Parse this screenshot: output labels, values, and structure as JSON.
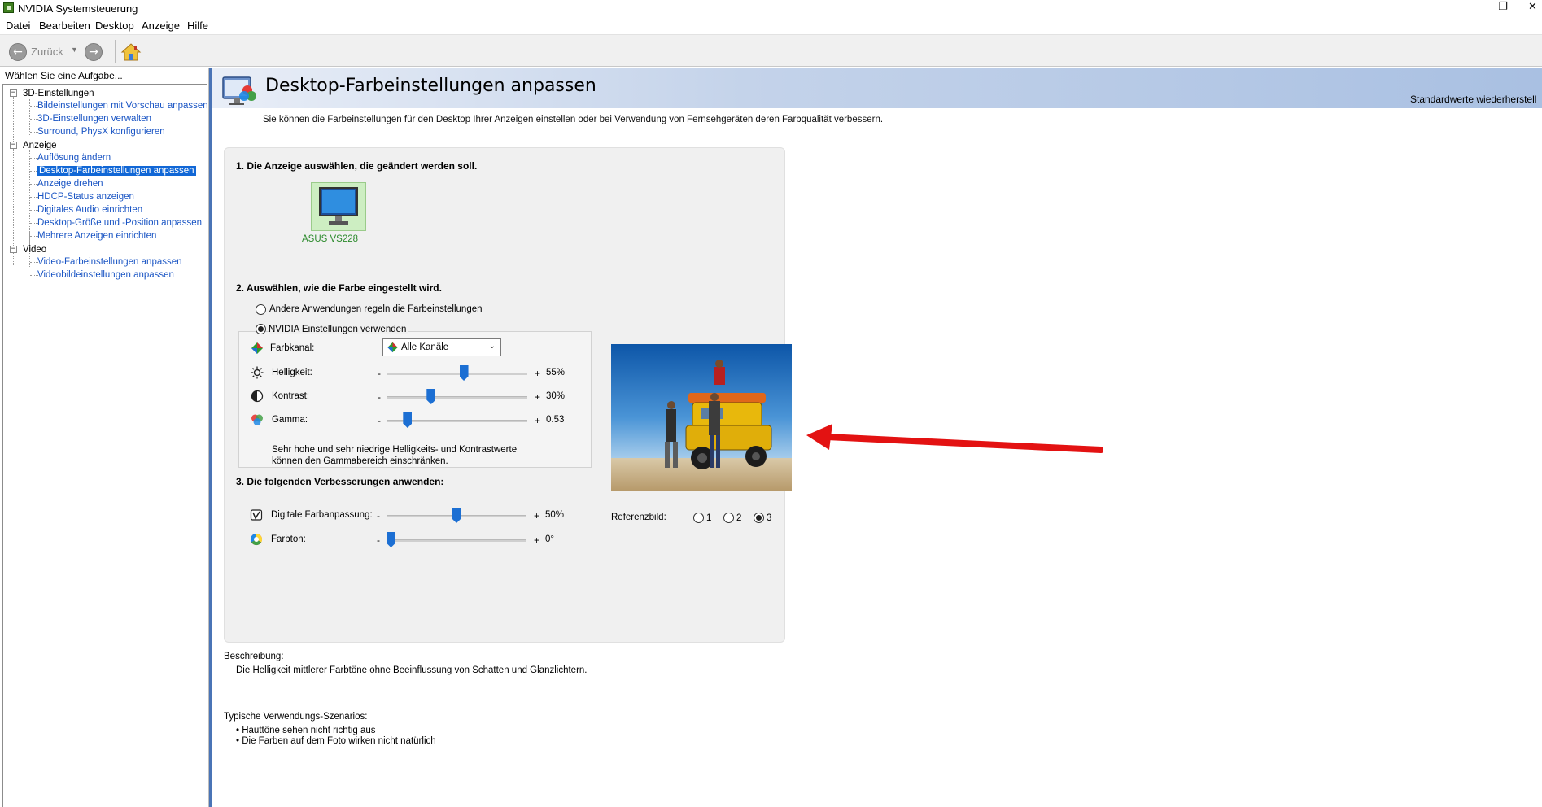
{
  "window": {
    "title": "NVIDIA Systemsteuerung",
    "minimize_glyph": "–",
    "restore_glyph": "❐",
    "close_glyph": "✕"
  },
  "menu": [
    "Datei",
    "Bearbeiten",
    "Desktop",
    "Anzeige",
    "Hilfe"
  ],
  "toolbar": {
    "back_label": "Zurück",
    "back_icon": "back-arrow-icon",
    "forward_icon": "forward-arrow-icon",
    "home_icon": "home-icon"
  },
  "sidebar": {
    "header": "Wählen Sie eine Aufgabe...",
    "categories": [
      {
        "label": "3D-Einstellungen",
        "items": [
          {
            "label": "Bildeinstellungen mit Vorschau anpassen"
          },
          {
            "label": "3D-Einstellungen verwalten"
          },
          {
            "label": "Surround, PhysX konfigurieren"
          }
        ]
      },
      {
        "label": "Anzeige",
        "items": [
          {
            "label": "Auflösung ändern"
          },
          {
            "label": "Desktop-Farbeinstellungen anpassen",
            "selected": true
          },
          {
            "label": "Anzeige drehen"
          },
          {
            "label": "HDCP-Status anzeigen"
          },
          {
            "label": "Digitales Audio einrichten"
          },
          {
            "label": "Desktop-Größe und -Position anpassen"
          },
          {
            "label": "Mehrere Anzeigen einrichten"
          }
        ]
      },
      {
        "label": "Video",
        "items": [
          {
            "label": "Video-Farbeinstellungen anpassen"
          },
          {
            "label": "Videobildeinstellungen anpassen"
          }
        ]
      }
    ]
  },
  "page": {
    "title": "Desktop-Farbeinstellungen anpassen",
    "restore_defaults": "Standardwerte wiederherstell",
    "subtitle": "Sie können die Farbeinstellungen für den Desktop Ihrer Anzeigen einstellen oder bei Verwendung von Fernsehgeräten deren Farbqualität verbessern.",
    "step1_title": "1. Die Anzeige auswählen, die geändert werden soll.",
    "monitor_name": "ASUS VS228",
    "step2_title": "2. Auswählen, wie die Farbe eingestellt wird.",
    "radio_other": "Andere Anwendungen regeln die Farbeinstellungen",
    "radio_nvidia": "NVIDIA Einstellungen verwenden",
    "color_mode_selected": "nvidia",
    "channel_label": "Farbkanal:",
    "channel_value": "Alle Kanäle",
    "minus": "-",
    "plus": "+",
    "sliders": [
      {
        "label": "Helligkeit:",
        "value_text": "55%",
        "fraction": 0.55,
        "icon": "brightness-icon"
      },
      {
        "label": "Kontrast:",
        "value_text": "30%",
        "fraction": 0.3,
        "icon": "contrast-icon"
      },
      {
        "label": "Gamma:",
        "value_text": "0.53",
        "fraction": 0.12,
        "icon": "gamma-icon"
      }
    ],
    "note": "Sehr hohe und sehr niedrige Helligkeits- und Kontrastwerte können den Gammabereich einschränken.",
    "step3_title": "3. Die folgenden Verbesserungen anwenden:",
    "enhancements": [
      {
        "label": "Digitale Farbanpassung:",
        "value_text": "50%",
        "fraction": 0.5,
        "icon": "vibrance-icon"
      },
      {
        "label": "Farbton:",
        "value_text": "0°",
        "fraction": 0.0,
        "icon": "hue-icon"
      }
    ],
    "reference_label": "Referenzbild:",
    "reference_options": [
      "1",
      "2",
      "3"
    ],
    "reference_selected": "3",
    "description_label": "Beschreibung:",
    "description_text": "Die Helligkeit mittlerer Farbtöne ohne Beeinflussung von Schatten und Glanzlichtern.",
    "scenarios_label": "Typische Verwendungs-Szenarios:",
    "scenarios": [
      "• Hauttöne sehen nicht richtig aus",
      "• Die Farben auf dem Foto wirken nicht natürlich"
    ]
  },
  "colors": {
    "selection": "#1167d6",
    "link": "#1a55c4",
    "slider_thumb": "#1c6fd3",
    "arrow": "#e31212",
    "monitor_label": "#2c8a2c"
  }
}
